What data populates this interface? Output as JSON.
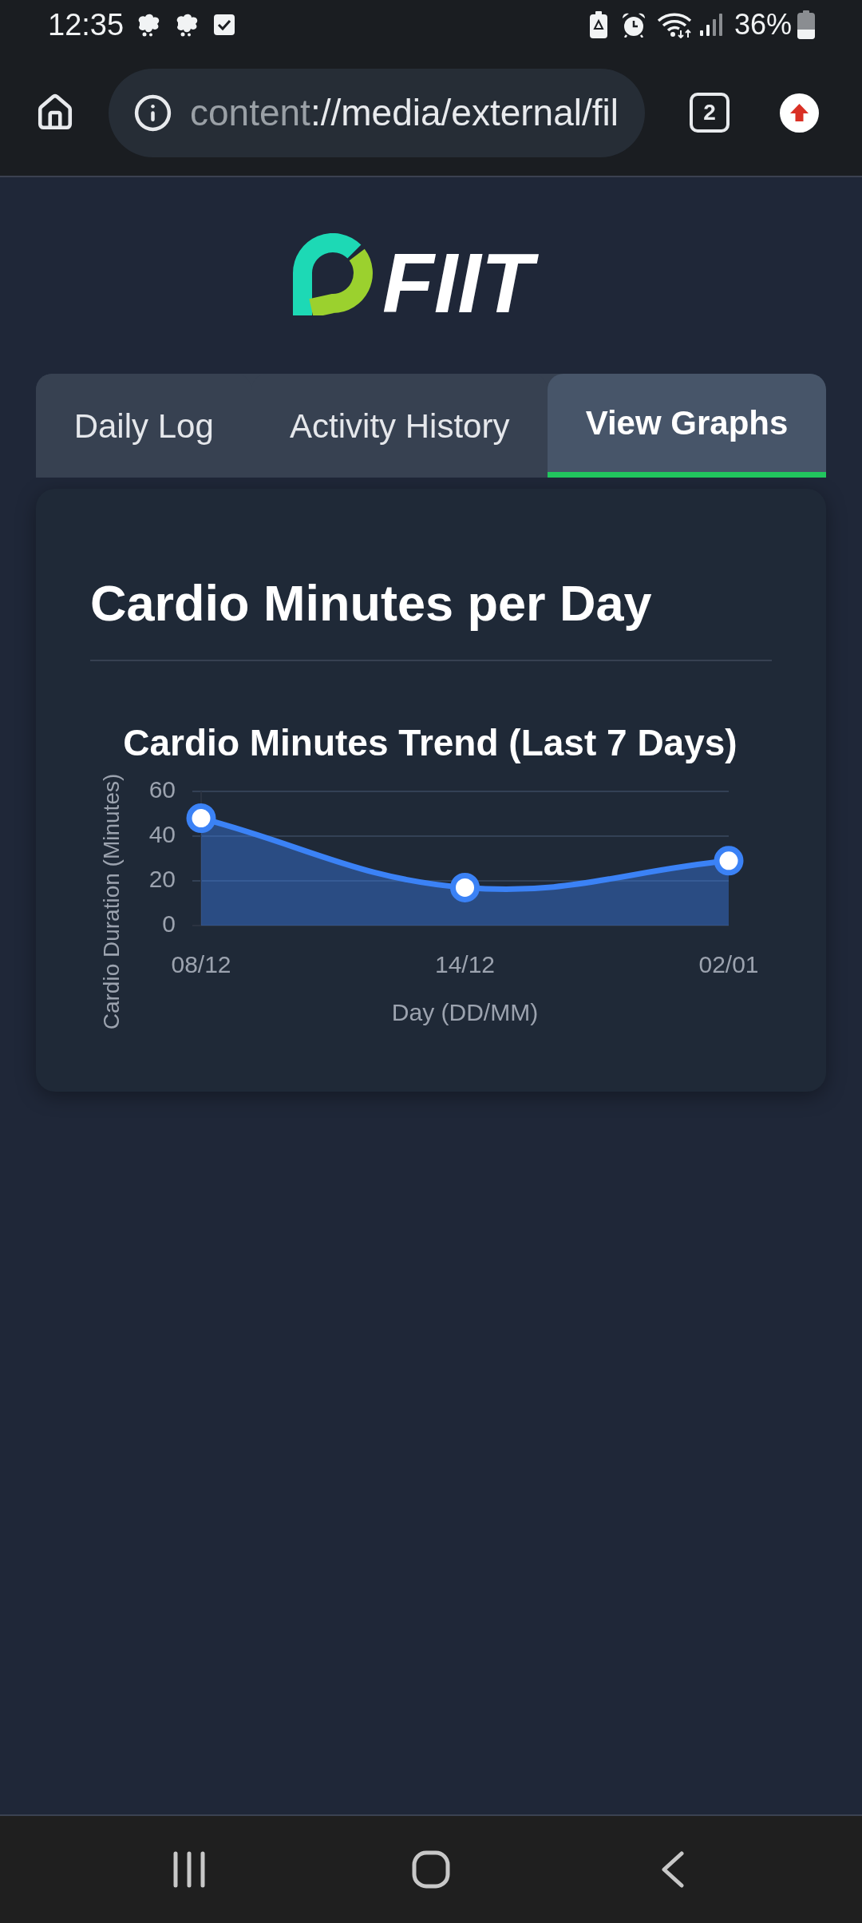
{
  "status_bar": {
    "time": "12:35",
    "battery": "36%"
  },
  "browser_toolbar": {
    "url": {
      "scheme": "content",
      "rest": "://media/external/fil"
    },
    "tab_count": "2"
  },
  "logo": {
    "text": "FIIT"
  },
  "tabs": [
    {
      "label": "Daily Log",
      "selected": false
    },
    {
      "label": "Activity History",
      "selected": false
    },
    {
      "label": "View Graphs",
      "selected": true
    }
  ],
  "card": {
    "heading": "Cardio Minutes per Day",
    "chart_data": {
      "type": "area",
      "title": "Cardio Minutes Trend (Last 7 Days)",
      "xlabel": "Day (DD/MM)",
      "ylabel": "Cardio Duration (Minutes)",
      "categories": [
        "08/12",
        "14/12",
        "02/01"
      ],
      "series": [
        {
          "color": "#3b82f6",
          "values": [
            48,
            17,
            29
          ]
        }
      ],
      "ylim": [
        0,
        60
      ],
      "yticks": [
        0,
        20,
        40,
        60
      ]
    }
  }
}
